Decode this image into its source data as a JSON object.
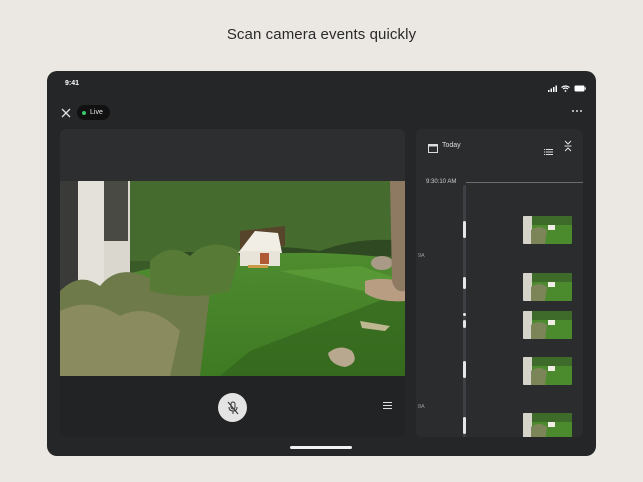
{
  "headline": "Scan camera events quickly",
  "status_bar": {
    "time": "9:41",
    "icons": [
      "signal-icon",
      "wifi-icon",
      "battery-icon"
    ]
  },
  "top_bar": {
    "live_label": "Live",
    "close_icon": "close-icon",
    "more_icon": "more-icon"
  },
  "video": {
    "icons": {
      "mic": "mic-off-icon",
      "menu": "menu-icon"
    }
  },
  "history": {
    "date_label": "Today",
    "current_time": "9:30:10 AM",
    "hour_labels": [
      "9A",
      "8A"
    ],
    "icons": {
      "calendar": "calendar-icon",
      "list": "list-icon",
      "collapse": "collapse-icon"
    }
  },
  "colors": {
    "page_background": "#ebe7e2",
    "device_background": "#252627",
    "live_dot": "#38c76a",
    "panel": "#2b2c2e"
  }
}
